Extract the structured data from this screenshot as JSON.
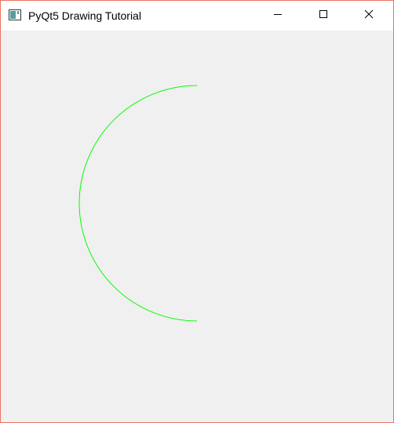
{
  "window": {
    "title": "PyQt5 Drawing Tutorial",
    "border_color": "#e8765f",
    "client_background": "#f0f0f0"
  },
  "titlebar": {
    "app_icon": "app-window-icon",
    "controls": [
      {
        "name": "minimize",
        "icon": "minimize-icon"
      },
      {
        "name": "maximize",
        "icon": "maximize-icon"
      },
      {
        "name": "close",
        "icon": "close-icon"
      }
    ]
  },
  "canvas": {
    "shapes": [
      {
        "type": "arc",
        "description": "left half circle",
        "stroke": "#00ff00"
      }
    ]
  }
}
